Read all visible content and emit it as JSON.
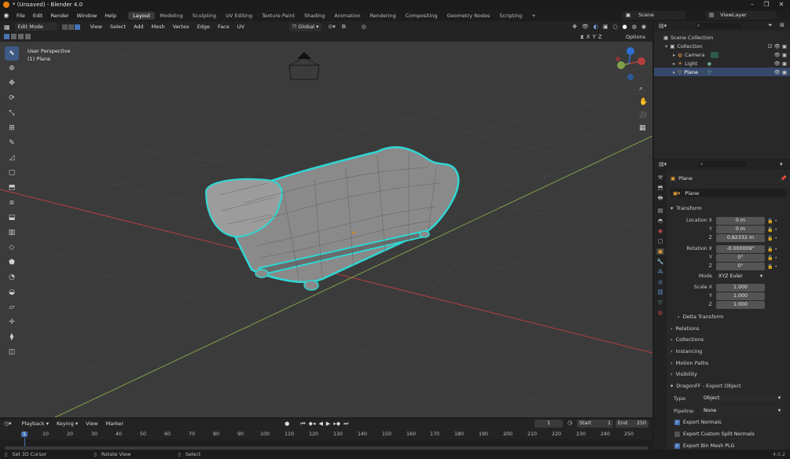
{
  "window": {
    "title": "* (Unsaved) - Blender 4.0"
  },
  "menu": [
    "File",
    "Edit",
    "Render",
    "Window",
    "Help"
  ],
  "workspaces": [
    {
      "label": "Layout",
      "active": true
    },
    {
      "label": "Modeling",
      "active": false
    },
    {
      "label": "Sculpting",
      "active": false
    },
    {
      "label": "UV Editing",
      "active": false
    },
    {
      "label": "Texture Paint",
      "active": false
    },
    {
      "label": "Shading",
      "active": false
    },
    {
      "label": "Animation",
      "active": false
    },
    {
      "label": "Rendering",
      "active": false
    },
    {
      "label": "Compositing",
      "active": false
    },
    {
      "label": "Geometry Nodes",
      "active": false
    },
    {
      "label": "Scripting",
      "active": false
    }
  ],
  "top_right": {
    "scene": "Scene",
    "view_layer": "ViewLayer"
  },
  "viewport_header": {
    "mode": "Edit Mode",
    "menus": [
      "View",
      "Select",
      "Add",
      "Mesh",
      "Vertex",
      "Edge",
      "Face",
      "UV"
    ],
    "orientation": "Global",
    "axes": [
      "X",
      "Y",
      "Z"
    ],
    "options": "Options"
  },
  "viewport": {
    "perspective": "User Perspective",
    "object": "(1) Plane",
    "colors": {
      "background": "#3b3b3b",
      "x_axis": "#b5403f",
      "y_axis": "#7fa04a",
      "selection": "#2fd7d3"
    }
  },
  "outliner": {
    "root": "Scene Collection",
    "items": [
      {
        "label": "Collection",
        "depth": 1,
        "icon": "collection-icon"
      },
      {
        "label": "Camera",
        "depth": 2,
        "icon": "camera-icon"
      },
      {
        "label": "Light",
        "depth": 2,
        "icon": "light-icon"
      },
      {
        "label": "Plane",
        "depth": 2,
        "icon": "mesh-icon",
        "selected": true
      }
    ]
  },
  "properties": {
    "object_name": "Plane",
    "datablock": "Plane",
    "transform": {
      "title": "Transform",
      "location": {
        "label": "Location X",
        "x": "0 m",
        "y": "0 m",
        "z": "0.82332 m"
      },
      "rotation": {
        "label": "Rotation X",
        "x": "-0.000009°",
        "y": "0°",
        "z": "0°"
      },
      "mode_label": "Mode",
      "mode": "XYZ Euler",
      "scale": {
        "label": "Scale X",
        "x": "1.000",
        "y": "1.000",
        "z": "1.000"
      },
      "axis_y": "Y",
      "axis_z": "Z",
      "delta": "Delta Transform"
    },
    "sections": [
      "Relations",
      "Collections",
      "Instancing",
      "Motion Paths",
      "Visibility"
    ],
    "dragonff": {
      "title": "DragonFF - Export Object",
      "type_label": "Type:",
      "type_value": "Object",
      "pipeline_label": "Pipeline:",
      "pipeline_value": "None",
      "export_normals": {
        "label": "Export Normals",
        "checked": true
      },
      "export_split": {
        "label": "Export Custom Split Normals",
        "checked": false
      },
      "export_bin": {
        "label": "Export Bin Mesh PLG",
        "checked": true
      }
    }
  },
  "timeline": {
    "menus": [
      "Playback",
      "Keying",
      "View",
      "Marker"
    ],
    "current_frame": "1",
    "start_label": "Start",
    "start": "1",
    "end_label": "End",
    "end": "250",
    "ticks": [
      "1",
      "10",
      "20",
      "30",
      "40",
      "50",
      "60",
      "70",
      "80",
      "90",
      "100",
      "110",
      "120",
      "130",
      "140",
      "150",
      "160",
      "170",
      "180",
      "190",
      "200",
      "210",
      "220",
      "230",
      "240",
      "250"
    ]
  },
  "status": {
    "left": "Set 3D Cursor",
    "mid": "Rotate View",
    "right": "Select",
    "version": "4.0.2"
  }
}
